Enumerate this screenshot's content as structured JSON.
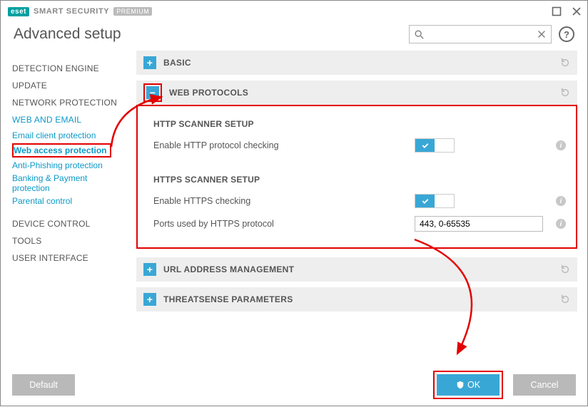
{
  "brand": {
    "logo": "eset",
    "name": "SMART SECURITY",
    "badge": "PREMIUM"
  },
  "page_title": "Advanced setup",
  "search": {
    "placeholder": ""
  },
  "sidebar": {
    "cats": [
      {
        "id": "detection",
        "label": "DETECTION ENGINE"
      },
      {
        "id": "update",
        "label": "UPDATE"
      },
      {
        "id": "network",
        "label": "NETWORK PROTECTION"
      },
      {
        "id": "webemail",
        "label": "WEB AND EMAIL",
        "link": true
      },
      {
        "id": "device",
        "label": "DEVICE CONTROL"
      },
      {
        "id": "tools",
        "label": "TOOLS"
      },
      {
        "id": "ui",
        "label": "USER INTERFACE"
      }
    ],
    "subs": [
      {
        "label": "Email client protection"
      },
      {
        "label": "Web access protection",
        "active": true
      },
      {
        "label": "Anti-Phishing protection"
      },
      {
        "label": "Banking & Payment protection"
      },
      {
        "label": "Parental control"
      }
    ]
  },
  "panels": {
    "basic": {
      "label": "BASIC"
    },
    "web_protocols": {
      "label": "WEB PROTOCOLS"
    },
    "url_mgmt": {
      "label": "URL ADDRESS MANAGEMENT"
    },
    "threatsense": {
      "label": "THREATSENSE PARAMETERS"
    }
  },
  "http": {
    "heading": "HTTP SCANNER SETUP",
    "enable_label": "Enable HTTP protocol checking",
    "enabled": true
  },
  "https": {
    "heading": "HTTPS SCANNER SETUP",
    "enable_label": "Enable HTTPS checking",
    "enabled": true,
    "ports_label": "Ports used by HTTPS protocol",
    "ports_value": "443, 0-65535"
  },
  "footer": {
    "default": "Default",
    "ok": "OK",
    "cancel": "Cancel"
  }
}
